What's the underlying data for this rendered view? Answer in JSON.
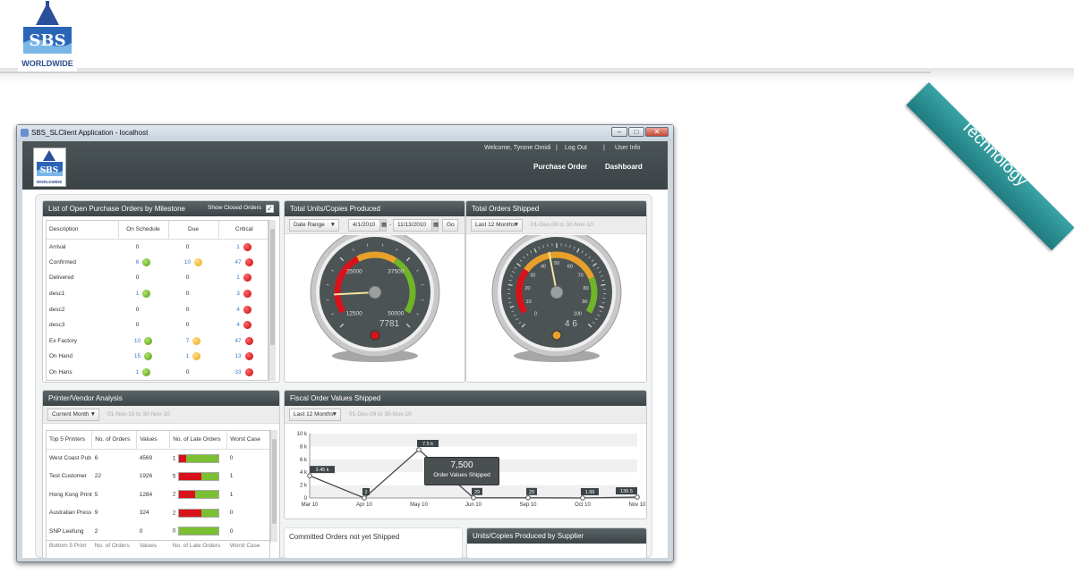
{
  "brand": {
    "logo_text": "SBS",
    "logo_sub": "WORLDWIDE",
    "ribbon": "Technology"
  },
  "window": {
    "title": "SBS_SLClient Application - localhost",
    "min": "–",
    "max": "□",
    "close": "✕"
  },
  "app": {
    "welcome": "Welcome, Tyrone Omidi",
    "sep": "|",
    "logout": "Log Out",
    "userinfo": "User Info",
    "nav": {
      "purchase_order": "Purchase Order",
      "dashboard": "Dashboard"
    },
    "logo_text": "SBS",
    "logo_sub": "WORLDWIDE"
  },
  "milestones": {
    "title": "List of Open Purchase Orders by Milestone",
    "show_closed": "Show Closed Orders",
    "columns": [
      "Description",
      "On Schedule",
      "Due",
      "Critical"
    ],
    "rows": [
      {
        "desc": "Arrival",
        "on": "0",
        "on_dot": "",
        "due": "0",
        "due_dot": "",
        "crit": "1",
        "crit_dot": "r"
      },
      {
        "desc": "Confirmed",
        "on": "6",
        "on_dot": "g",
        "due": "10",
        "due_dot": "y",
        "crit": "47",
        "crit_dot": "r"
      },
      {
        "desc": "Delivered",
        "on": "0",
        "on_dot": "",
        "due": "0",
        "due_dot": "",
        "crit": "1",
        "crit_dot": "r"
      },
      {
        "desc": "desc1",
        "on": "1",
        "on_dot": "g",
        "due": "0",
        "due_dot": "",
        "crit": "3",
        "crit_dot": "r"
      },
      {
        "desc": "desc2",
        "on": "0",
        "on_dot": "",
        "due": "0",
        "due_dot": "",
        "crit": "4",
        "crit_dot": "r"
      },
      {
        "desc": "desc3",
        "on": "0",
        "on_dot": "",
        "due": "0",
        "due_dot": "",
        "crit": "4",
        "crit_dot": "r"
      },
      {
        "desc": "Ex Factory",
        "on": "10",
        "on_dot": "g",
        "due": "7",
        "due_dot": "y",
        "crit": "47",
        "crit_dot": "r"
      },
      {
        "desc": "On Hand",
        "on": "15",
        "on_dot": "g",
        "due": "1",
        "due_dot": "y",
        "crit": "13",
        "crit_dot": "r"
      },
      {
        "desc": "On Hans",
        "on": "1",
        "on_dot": "g",
        "due": "0",
        "due_dot": "",
        "crit": "33",
        "crit_dot": "r"
      }
    ]
  },
  "units": {
    "title": "Total Units/Copies Produced",
    "range_select": "Date Range",
    "date_from": "4/1/2010",
    "date_to": "11/13/2010",
    "dash": "-",
    "go": "Go",
    "gauge": {
      "value": 7781,
      "display": "7781",
      "ticks": [
        "12500",
        "25000",
        "37500",
        "50000"
      ],
      "max": 50000,
      "needle": 7781
    }
  },
  "shipped": {
    "title": "Total Orders Shipped",
    "range_select": "Last 12 Months",
    "range_text": "01-Dec-09 to 30-Nov-10",
    "gauge": {
      "value": 46,
      "display": "4 6",
      "ticks": [
        "0",
        "10",
        "20",
        "30",
        "40",
        "50",
        "60",
        "70",
        "80",
        "90",
        "100"
      ],
      "max": 100,
      "needle": 46
    }
  },
  "printers": {
    "title": "Printer/Vendor Analysis",
    "range_select": "Current Month",
    "range_text": "01-Nov-10 to 30-Nov-10",
    "columns": [
      "Top 5 Printers",
      "No. of Orders",
      "Values",
      "No. of Late Orders",
      "Worst Case"
    ],
    "rows": [
      {
        "name": "West Coast Pub",
        "orders": "6",
        "values": "4569",
        "late": "1",
        "late_frac": 0.17,
        "worst": "0"
      },
      {
        "name": "Test Customer",
        "orders": "22",
        "values": "1926",
        "late": "5",
        "late_frac": 0.55,
        "worst": "1"
      },
      {
        "name": "Hong Kong Print",
        "orders": "5",
        "values": "1284",
        "late": "2",
        "late_frac": 0.4,
        "worst": "1"
      },
      {
        "name": "Australian Press",
        "orders": "9",
        "values": "324",
        "late": "2",
        "late_frac": 0.55,
        "worst": "0"
      },
      {
        "name": "SNP Leefung",
        "orders": "2",
        "values": "0",
        "late": "0",
        "late_frac": 0,
        "worst": "0"
      }
    ],
    "bottom_columns": [
      "Bottom 5 Print",
      "No. of Orders",
      "Values",
      "No. of Late Orders",
      "Worst Case"
    ]
  },
  "fiscal": {
    "title": "Fiscal Order Values Shipped",
    "range_select": "Last 12 Months",
    "range_text": "01-Dec-09 to 30-Nov-10",
    "tooltip_value": "7,500",
    "tooltip_label": "Order Values Shipped"
  },
  "committed": {
    "title": "Committed Orders not yet Shipped"
  },
  "supplier": {
    "title": "Units/Copies Produced by Supplier"
  },
  "chart_data": {
    "type": "line",
    "categories": [
      "Mar 10",
      "Apr 10",
      "May 10",
      "Jun 10",
      "Sep 10",
      "Oct 10",
      "Nov 10"
    ],
    "values": [
      3450,
      2,
      7500,
      29,
      29,
      1.99,
      136.5
    ],
    "labels": [
      "3.45 k",
      "2",
      "7.5 k",
      "29",
      "29",
      "1.99",
      "136.5"
    ],
    "yticks": [
      "0",
      "2 k",
      "4 k",
      "6 k",
      "8 k",
      "10 k"
    ],
    "ylim": [
      0,
      10000
    ],
    "title": "Fiscal Order Values Shipped",
    "color": "#4a4a4a"
  }
}
